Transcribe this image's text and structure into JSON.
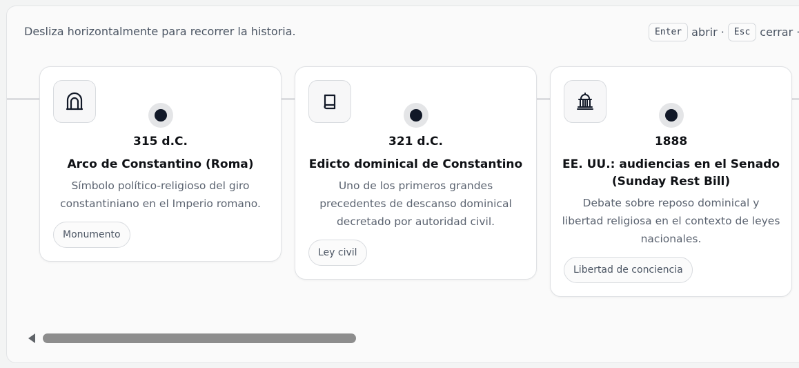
{
  "hint": "Desliza horizontalmente para recorrer la historia.",
  "keys": {
    "enter_key": "Enter",
    "enter_label": "abrir",
    "esc_key": "Esc",
    "esc_label": "cerrar",
    "separator": "·"
  },
  "events": [
    {
      "icon": "arch-icon",
      "year": "315 d.C.",
      "title": "Arco de Constantino (Roma)",
      "description": "Símbolo político-religioso del giro constantiniano en el Imperio romano.",
      "tag": "Monumento"
    },
    {
      "icon": "book-icon",
      "year": "321 d.C.",
      "title": "Edicto dominical de Constantino",
      "description": "Uno de los primeros grandes precedentes de descanso dominical decretado por autoridad civil.",
      "tag": "Ley civil"
    },
    {
      "icon": "capitol-icon",
      "year": "1888",
      "title": "EE. UU.: audiencias en el Senado (Sunday Rest Bill)",
      "description": "Debate sobre reposo dominical y libertad religiosa en el contexto de leyes nacionales.",
      "tag": "Libertad de conciencia"
    }
  ],
  "colors": {
    "dot": "#111827",
    "scroll_thumb": "#8d8d8d"
  }
}
